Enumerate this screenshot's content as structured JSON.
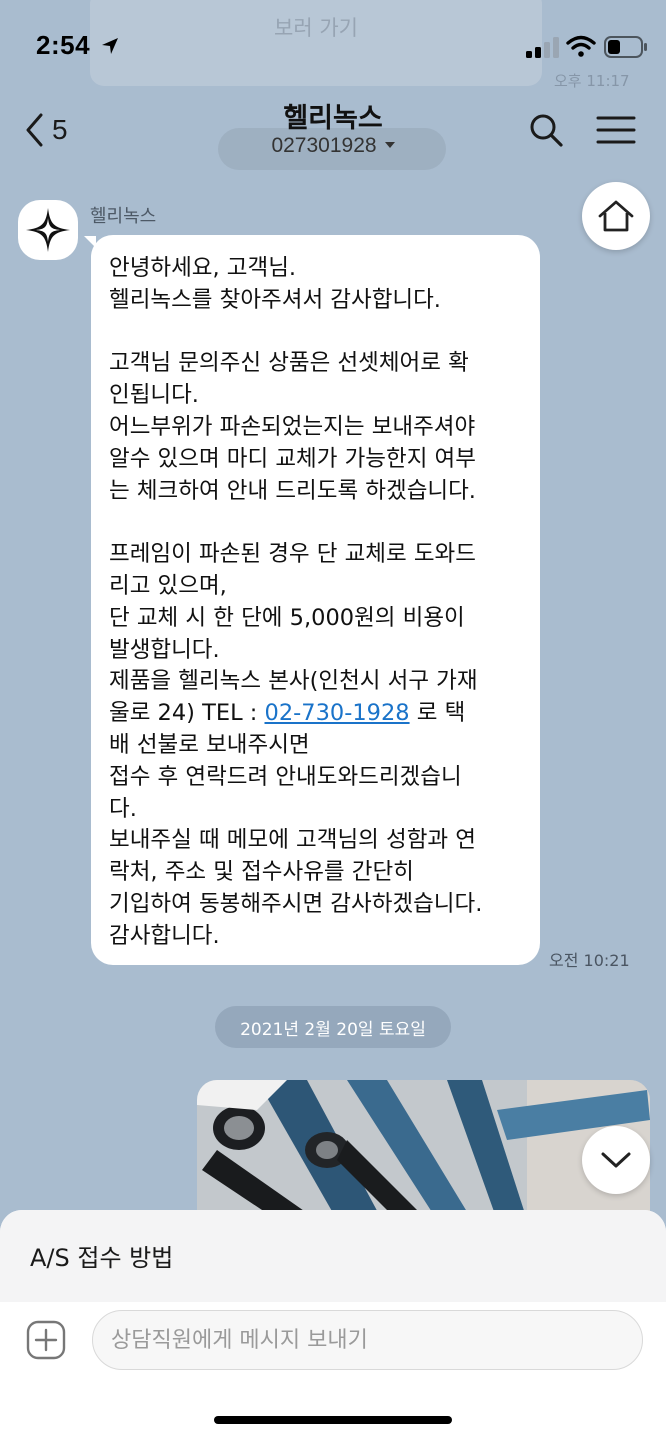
{
  "status_bar": {
    "time": "2:54"
  },
  "background_remnants": {
    "button_label": "보러 가기",
    "time": "오후 11:17"
  },
  "header": {
    "back_count": "5",
    "title": "헬리녹스",
    "subtitle": "027301928"
  },
  "message": {
    "sender": "헬리녹스",
    "lines": [
      "안녕하세요, 고객님.",
      "헬리녹스를 찾아주셔서 감사합니다.",
      "",
      "고객님 문의주신 상품은 선셋체어로 확",
      "인됩니다.",
      "어느부위가 파손되었는지는 보내주셔야",
      "알수 있으며 마디 교체가 가능한지 여부",
      "는 체크하여 안내 드리도록 하겠습니다.",
      "",
      "프레임이 파손된 경우 단 교체로 도와드",
      "리고 있으며,",
      "단 교체 시 한 단에 5,000원의 비용이",
      "발생합니다.",
      "제품을 헬리녹스 본사(인천시 서구 가재"
    ],
    "address_line_prefix": "울로 24) TEL : ",
    "phone": "02-730-1928",
    "address_line_suffix": " 로 택",
    "lines_after": [
      "배 선불로 보내주시면",
      "접수 후 연락드려 안내도와드리겠습니",
      "다.",
      "보내주실 때 메모에 고객님의 성함과 연",
      "락처, 주소 및 접수사유를 간단히",
      "기입하여 동봉해주시면 감사하겠습니다.",
      "감사합니다."
    ],
    "time": "오전 10:21"
  },
  "date_divider": "2021년 2월 20일 토요일",
  "bottom": {
    "menu_label": "A/S 접수 방법",
    "input_placeholder": "상담직원에게 메시지 보내기"
  },
  "colors": {
    "chat_background": "#a9bccf",
    "link": "#1a73c9",
    "date_pill": "#95a8bc"
  },
  "icons": [
    "location-arrow-icon",
    "signal-icon",
    "wifi-icon",
    "battery-icon",
    "back-chevron-icon",
    "search-icon",
    "menu-icon",
    "home-icon",
    "chevron-down-icon",
    "plus-icon",
    "helinox-logo-icon"
  ]
}
